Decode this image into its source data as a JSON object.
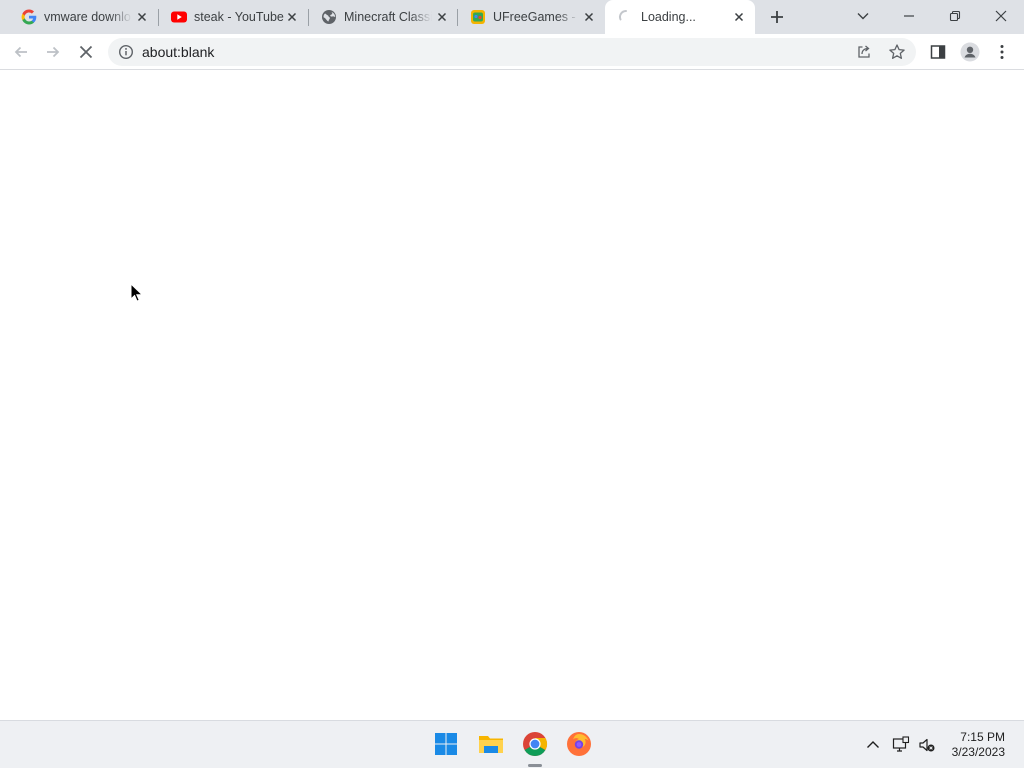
{
  "tabs": [
    {
      "title": "vmware downlo",
      "icon": "google-icon",
      "active": false
    },
    {
      "title": "steak - YouTube",
      "icon": "youtube-icon",
      "active": false
    },
    {
      "title": "Minecraft Classi",
      "icon": "globe-icon",
      "active": false
    },
    {
      "title": "UFreeGames - F",
      "icon": "ufreegames-icon",
      "active": false
    },
    {
      "title": "Loading...",
      "icon": "loading-spinner-icon",
      "active": true
    }
  ],
  "address_bar": {
    "url": "about:blank"
  },
  "taskbar": {
    "apps": [
      "windows-start-icon",
      "file-explorer-icon",
      "chrome-icon",
      "firefox-icon"
    ],
    "time": "7:15 PM",
    "date": "3/23/2023"
  },
  "colors": {
    "tabstrip": "#dee1e6",
    "omnibox": "#f1f3f4",
    "icon_gray": "#5f6368",
    "taskbar": "#eef0f3"
  }
}
